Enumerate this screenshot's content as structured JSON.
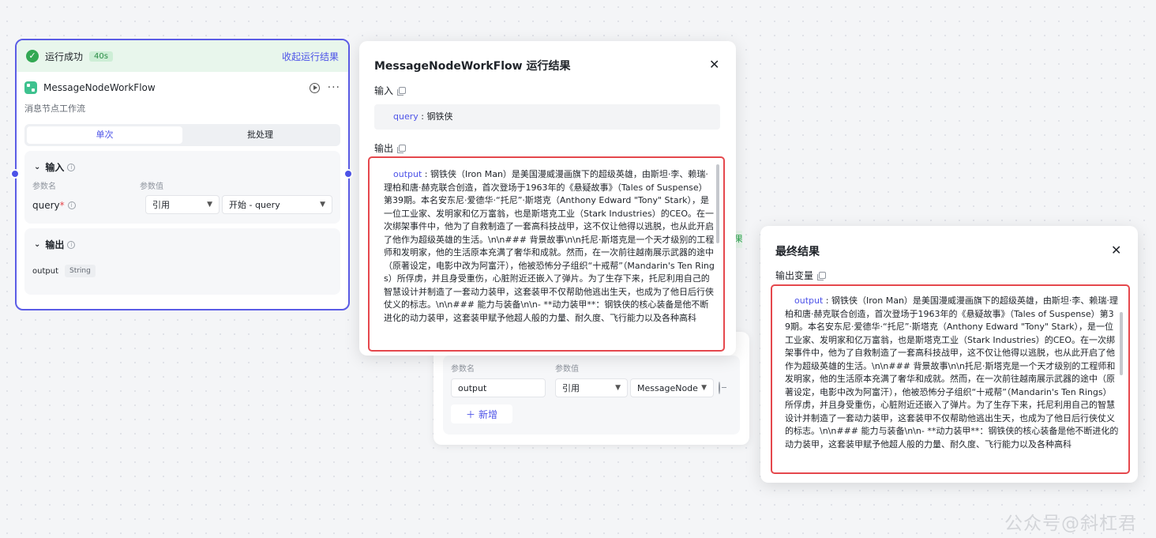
{
  "node": {
    "status": "运行成功",
    "duration": "40s",
    "collapse_label": "收起运行结果",
    "title": "MessageNodeWorkFlow",
    "description": "消息节点工作流",
    "tabs": [
      "单次",
      "批处理"
    ],
    "input_section": {
      "title": "输入",
      "col_name": "参数名",
      "col_value": "参数值",
      "param": "query",
      "ref_type": "引用",
      "ref_value": "开始 - query"
    },
    "output_section": {
      "title": "输出",
      "param": "output",
      "type": "String"
    }
  },
  "end_node": {
    "col_name": "参数名",
    "col_value": "参数值",
    "param": "output",
    "ref_type": "引用",
    "ref_value": "MessageNode",
    "add_label": "新增",
    "sliver": "果"
  },
  "run_dialog": {
    "title": "MessageNodeWorkFlow 运行结果",
    "input_label": "输入",
    "input_key": "query",
    "input_value": "钢铁侠",
    "output_label": "输出",
    "output_key": "output",
    "output_text": "钢铁侠（Iron Man）是美国漫威漫画旗下的超级英雄，由斯坦·李、赖瑞·理柏和唐·赫克联合创造，首次登场于1963年的《悬疑故事》（Tales of Suspense）第39期。本名安东尼·爱德华·“托尼”·斯塔克（Anthony Edward \"Tony\" Stark），是一位工业家、发明家和亿万富翁，也是斯塔克工业（Stark Industries）的CEO。在一次绑架事件中，他为了自救制造了一套高科技战甲，这不仅让他得以逃脱，也从此开启了他作为超级英雄的生活。\\n\\n### 背景故事\\n\\n托尼·斯塔克是一个天才级别的工程师和发明家，他的生活原本充满了奢华和成就。然而，在一次前往越南展示武器的途中（原著设定，电影中改为阿富汗），他被恐怖分子组织“十戒帮”（Mandarin's Ten Rings）所俘虏，并且身受重伤，心脏附近还嵌入了弹片。为了生存下来，托尼利用自己的智慧设计并制造了一套动力装甲，这套装甲不仅帮助他逃出生天，也成为了他日后行侠仗义的标志。\\n\\n### 能力与装备\\n\\n- **动力装甲**：钢铁侠的核心装备是他不断进化的动力装甲，这套装甲赋予他超人般的力量、耐久度、飞行能力以及各种高科"
  },
  "final_dialog": {
    "title": "最终结果",
    "output_var_label": "输出变量",
    "output_key": "output"
  },
  "watermark": "公众号@斜杠君"
}
